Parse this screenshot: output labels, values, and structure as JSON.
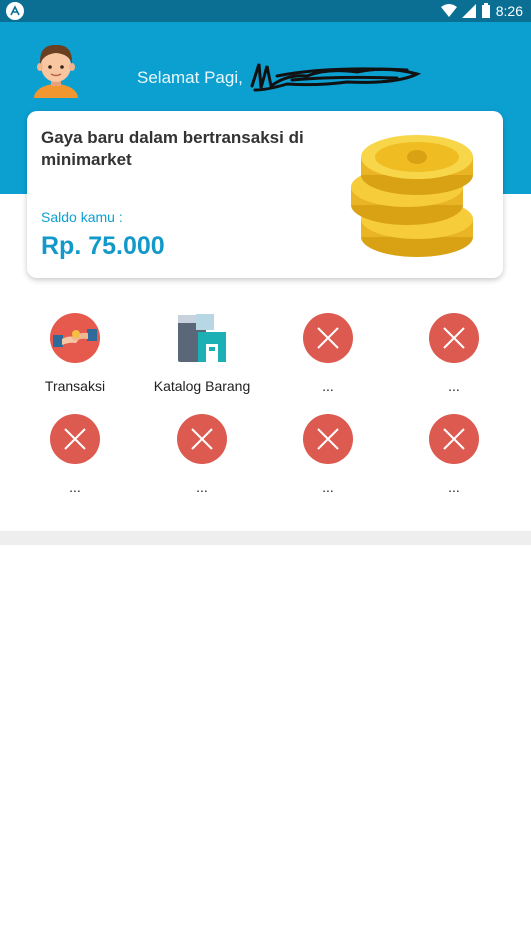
{
  "status_bar": {
    "time": "8:26"
  },
  "header": {
    "greeting": "Selamat Pagi,"
  },
  "card": {
    "title": "Gaya baru dalam bertransaksi di minimarket",
    "balance_label": "Saldo kamu :",
    "balance_value": "Rp. 75.000"
  },
  "menu": [
    {
      "label": "Transaksi",
      "icon": "transaction-icon"
    },
    {
      "label": "Katalog Barang",
      "icon": "catalog-icon"
    },
    {
      "label": "...",
      "icon": "close-icon"
    },
    {
      "label": "...",
      "icon": "close-icon"
    },
    {
      "label": "...",
      "icon": "close-icon"
    },
    {
      "label": "...",
      "icon": "close-icon"
    },
    {
      "label": "...",
      "icon": "close-icon"
    },
    {
      "label": "...",
      "icon": "close-icon"
    }
  ],
  "colors": {
    "primary": "#0ca0d1",
    "status_bar": "#0b6f94",
    "close_red": "#dc5a4f"
  }
}
